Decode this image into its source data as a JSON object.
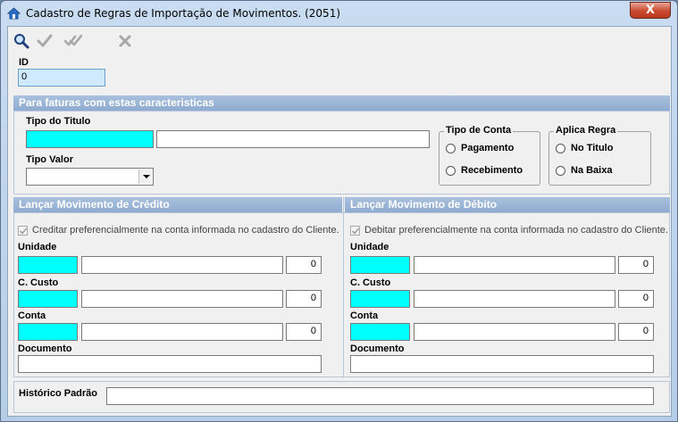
{
  "window": {
    "title": "Cadastro de Regras de Importação de Movimentos. (2051)",
    "close_symbol": "X"
  },
  "toolbar": {
    "search_icon": "search-icon",
    "confirm_icon": "check-icon",
    "confirm_all_icon": "double-check-icon",
    "cancel_icon": "x-icon"
  },
  "id_field": {
    "label": "ID",
    "value": "0"
  },
  "faturas": {
    "header": "Para faturas com estas caracteristicas",
    "tipo_titulo_label": "Tipo do Titulo",
    "tipo_titulo_code": "",
    "tipo_titulo_desc": "",
    "tipo_valor_label": "Tipo Valor",
    "tipo_valor_selected": "",
    "tipo_conta": {
      "title": "Tipo de Conta",
      "options": [
        "Pagamento",
        "Recebimento"
      ]
    },
    "aplica_regra": {
      "title": "Aplica Regra",
      "options": [
        "No Titulo",
        "Na Baixa"
      ]
    }
  },
  "credito": {
    "header": "Lançar Movimento de Crédito",
    "checkbox_label": "Creditar preferencialmente na conta informada no cadastro do Cliente.",
    "unidade_label": "Unidade",
    "unidade_value": "0",
    "custo_label": "C. Custo",
    "custo_value": "0",
    "conta_label": "Conta",
    "conta_value": "0",
    "documento_label": "Documento",
    "documento_value": ""
  },
  "debito": {
    "header": "Lançar Movimento de Débito",
    "checkbox_label": "Debitar preferencialmente na conta informada no cadastro do Cliente.",
    "unidade_label": "Unidade",
    "unidade_value": "0",
    "custo_label": "C. Custo",
    "custo_value": "0",
    "conta_label": "Conta",
    "conta_value": "0",
    "documento_label": "Documento",
    "documento_value": ""
  },
  "historico": {
    "label": "Histórico Padrão",
    "value": ""
  },
  "colors": {
    "required_field": "#00ffff",
    "section_header": "#9ab4d6"
  }
}
